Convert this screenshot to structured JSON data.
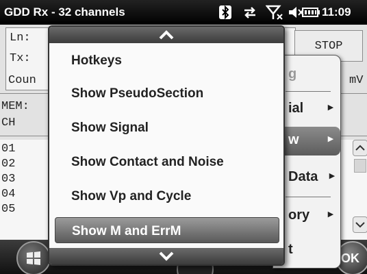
{
  "statusbar": {
    "title": "GDD Rx - 32 channels",
    "time": "11:09",
    "icons": [
      "bluetooth-icon",
      "data-sync-icon",
      "no-signal-icon",
      "volume-muted-icon",
      "battery-icon"
    ]
  },
  "app": {
    "ln_label": "Ln:",
    "tx_label": "Tx:",
    "count_label": "Coun",
    "stop_label": "STOP",
    "unit_label": "mV",
    "mem_label": "MEM:",
    "ch_label": "CH",
    "rows": [
      "01",
      "02",
      "03",
      "04",
      "05"
    ]
  },
  "submenu": {
    "items": [
      {
        "label": "g",
        "arrow": ""
      },
      {
        "label": "ial",
        "arrow": "▸"
      },
      {
        "label": "w",
        "arrow": "▸"
      },
      {
        "label": "Data",
        "arrow": "▸"
      },
      {
        "label": "ory",
        "arrow": "▸"
      },
      {
        "label": "t",
        "arrow": ""
      }
    ]
  },
  "menu": {
    "items": [
      {
        "label": "Hotkeys"
      },
      {
        "label": "Show PseudoSection"
      },
      {
        "label": "Show Signal"
      },
      {
        "label": "Show Contact and Noise"
      },
      {
        "label": "Show Vp and Cycle"
      },
      {
        "label": "Show M and ErrM"
      }
    ],
    "selected_index": 5
  },
  "softbar": {
    "ok_label": "OK"
  }
}
